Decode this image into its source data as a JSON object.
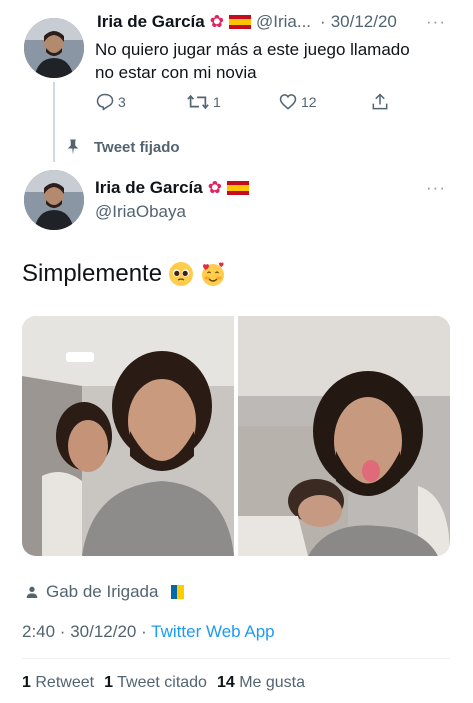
{
  "first_tweet": {
    "display_name": "Iria de García",
    "handle": "@Iria...",
    "separator": "·",
    "date": "30/12/20",
    "more": "···",
    "text_line1": "No quiero jugar más a este juego llamado",
    "text_line2": "no estar con mi novia",
    "reply_count": "3",
    "retweet_count": "1",
    "like_count": "12"
  },
  "pinned_label": "Tweet fijado",
  "main_tweet": {
    "display_name": "Iria de García",
    "handle": "@IriaObaya",
    "more": "···",
    "text": "Simplemente",
    "emojis": [
      "pleading-face",
      "smiling-face-with-hearts"
    ],
    "tagged_user": "Gab de Irigada",
    "timestamp": "2:40 · 30/12/20 · ",
    "source": "Twitter Web App",
    "retweets_num": "1",
    "retweets_label": "Retweet",
    "quotes_num": "1",
    "quotes_label": "Tweet citado",
    "likes_num": "14",
    "likes_label": "Me gusta"
  },
  "colors": {
    "accent": "#1d9bf0",
    "muted": "#536471",
    "flag_red": "#c60b1e",
    "flag_yellow": "#ffc400"
  }
}
